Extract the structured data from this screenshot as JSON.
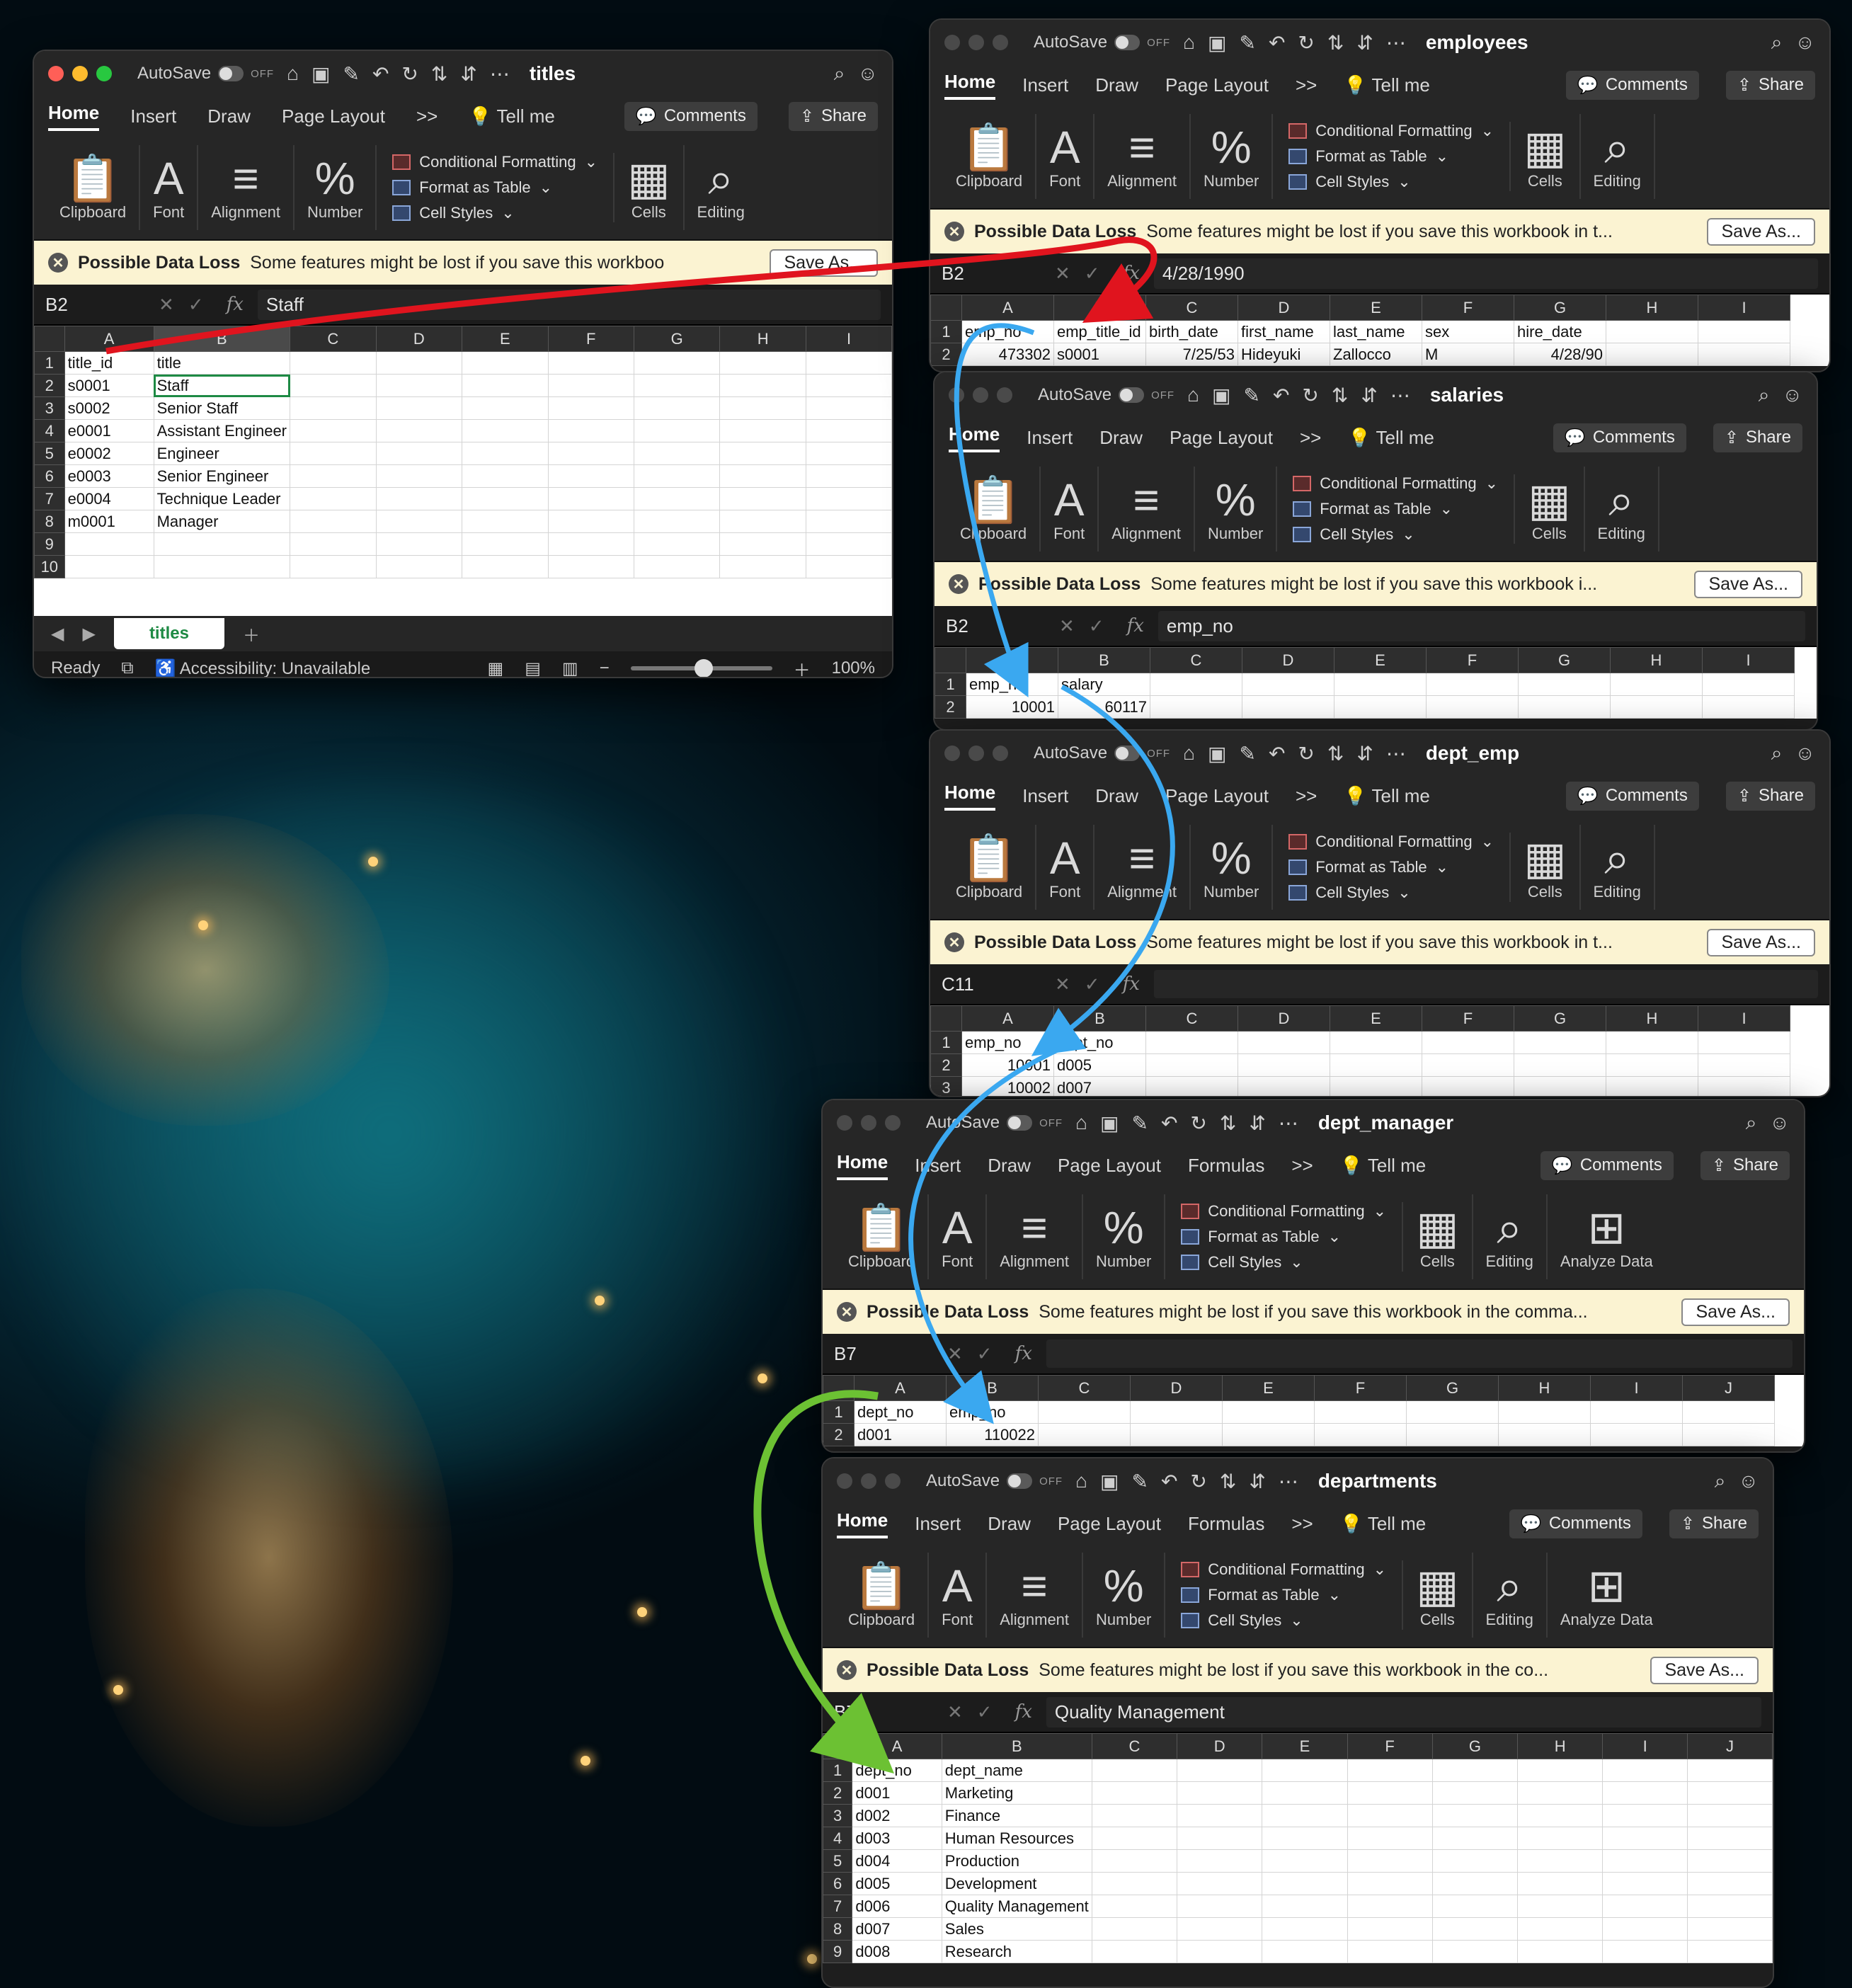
{
  "common": {
    "autosave": "AutoSave",
    "off": "OFF",
    "tabs": {
      "home": "Home",
      "insert": "Insert",
      "draw": "Draw",
      "page_layout": "Page Layout",
      "formulas": "Formulas",
      "more": ">>",
      "tell_me": "Tell me"
    },
    "comments": "Comments",
    "share": "Share",
    "groups": {
      "clipboard": "Clipboard",
      "font": "Font",
      "alignment": "Alignment",
      "number": "Number",
      "cells": "Cells",
      "editing": "Editing",
      "analyze": "Analyze Data"
    },
    "styles": {
      "conditional": "Conditional Formatting",
      "format_table": "Format as Table",
      "cell_styles": "Cell Styles"
    },
    "warn_title": "Possible Data Loss",
    "save_as": "Save As...",
    "columns": [
      "A",
      "B",
      "C",
      "D",
      "E",
      "F",
      "G",
      "H",
      "I",
      "J"
    ]
  },
  "titles": {
    "doc": "titles",
    "warning": "Some features might be lost if you save this workboo",
    "namebox": "B2",
    "formula": "Staff",
    "rows": [
      [
        "title_id",
        "title"
      ],
      [
        "s0001",
        "Staff"
      ],
      [
        "s0002",
        "Senior Staff"
      ],
      [
        "e0001",
        "Assistant Engineer"
      ],
      [
        "e0002",
        "Engineer"
      ],
      [
        "e0003",
        "Senior Engineer"
      ],
      [
        "e0004",
        "Technique Leader"
      ],
      [
        "m0001",
        "Manager"
      ],
      [
        "",
        ""
      ],
      [
        "",
        ""
      ]
    ],
    "sheet_tab": "titles",
    "status_ready": "Ready",
    "accessibility": "Accessibility: Unavailable",
    "zoom": "100%"
  },
  "employees": {
    "doc": "employees",
    "warning": "Some features might be lost if you save this workbook in t...",
    "namebox": "B2",
    "formula": "4/28/1990",
    "rows": [
      [
        "emp_no",
        "emp_title_id",
        "birth_date",
        "first_name",
        "last_name",
        "sex",
        "hire_date"
      ],
      [
        "473302",
        "s0001",
        "7/25/53",
        "Hideyuki",
        "Zallocco",
        "M",
        "4/28/90"
      ]
    ]
  },
  "salaries": {
    "doc": "salaries",
    "warning": "Some features might be lost if you save this workbook i...",
    "namebox": "B2",
    "formula": "emp_no",
    "rows": [
      [
        "emp_no",
        "salary"
      ],
      [
        "10001",
        "60117"
      ]
    ]
  },
  "dept_emp": {
    "doc": "dept_emp",
    "warning": "Some features might be lost if you save this workbook in t...",
    "namebox": "C11",
    "formula": "",
    "rows": [
      [
        "emp_no",
        "dept_no"
      ],
      [
        "10001",
        "d005"
      ],
      [
        "10002",
        "d007"
      ]
    ]
  },
  "dept_manager": {
    "doc": "dept_manager",
    "warning": "Some features might be lost if you save this workbook in the comma...",
    "namebox": "B7",
    "formula": "",
    "rows": [
      [
        "dept_no",
        "emp_no"
      ],
      [
        "d001",
        "110022"
      ]
    ]
  },
  "departments": {
    "doc": "departments",
    "warning": "Some features might be lost if you save this workbook in the co...",
    "namebox": "B7",
    "formula": "Quality Management",
    "rows": [
      [
        "dept_no",
        "dept_name"
      ],
      [
        "d001",
        "Marketing"
      ],
      [
        "d002",
        "Finance"
      ],
      [
        "d003",
        "Human Resources"
      ],
      [
        "d004",
        "Production"
      ],
      [
        "d005",
        "Development"
      ],
      [
        "d006",
        "Quality Management"
      ],
      [
        "d007",
        "Sales"
      ],
      [
        "d008",
        "Research"
      ]
    ]
  },
  "arrow_colors": {
    "red": "#e0141e",
    "blue": "#3aa8f0",
    "green": "#6cc133"
  }
}
